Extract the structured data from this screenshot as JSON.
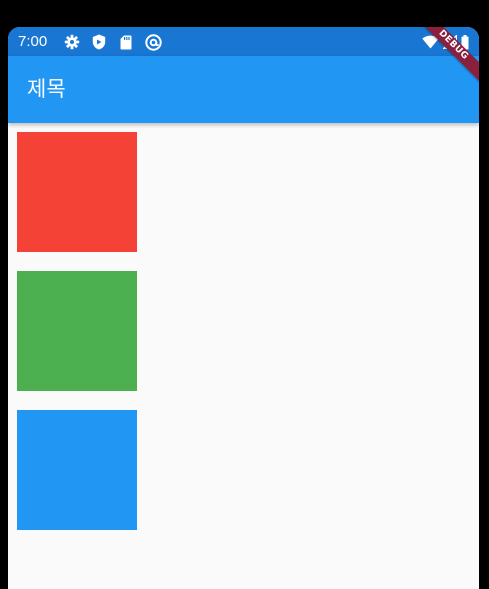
{
  "status_bar": {
    "time": "7:00",
    "left_icons": [
      "gear-icon",
      "shield-icon",
      "sd-card-icon",
      "at-sign-icon"
    ],
    "right_icons": [
      "wifi-icon",
      "signal-icon",
      "battery-icon"
    ],
    "color": "#1976D2"
  },
  "app_bar": {
    "title": "제목",
    "color": "#2196F3"
  },
  "boxes": [
    {
      "name": "red-box",
      "color": "#F44336"
    },
    {
      "name": "green-box",
      "color": "#4CAF50"
    },
    {
      "name": "blue-box",
      "color": "#2196F3"
    }
  ],
  "debug_banner": {
    "label": "DEBUG",
    "color": "#8A1F3E"
  },
  "background_color": "#FAFAFA"
}
